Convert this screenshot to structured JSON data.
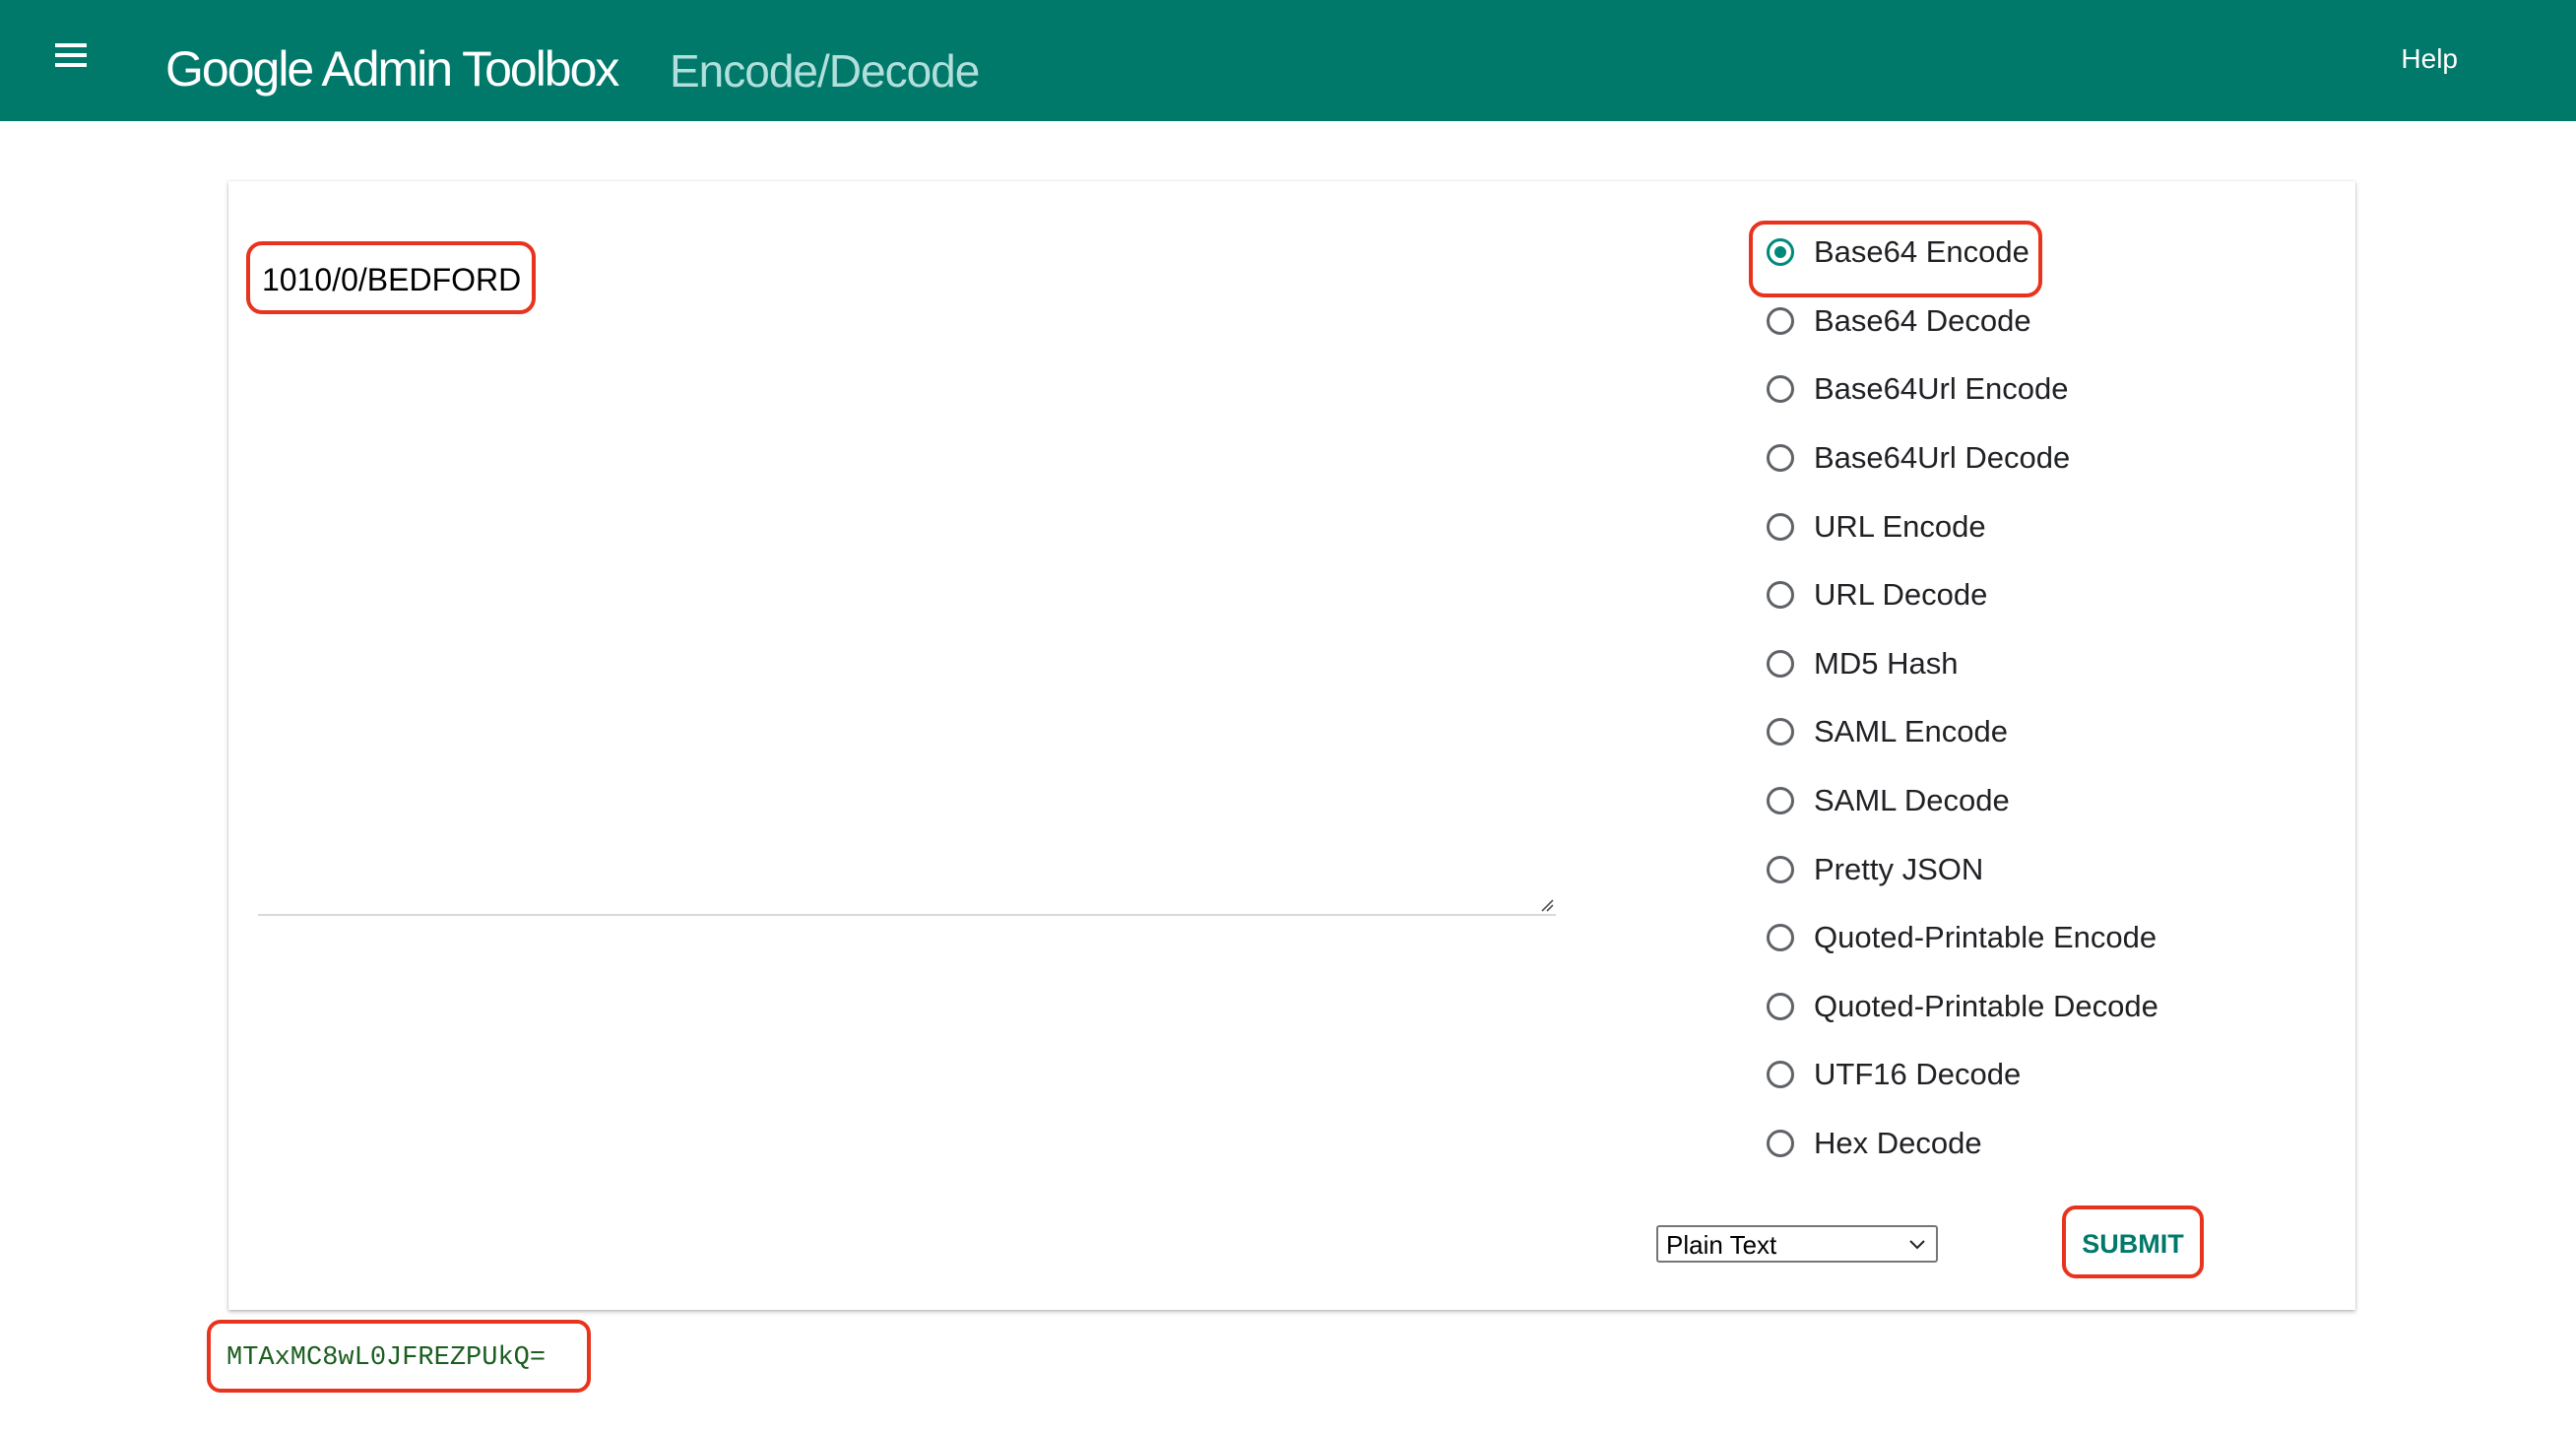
{
  "header": {
    "brand": "Google Admin Toolbox",
    "subtitle": "Encode/Decode",
    "help_label": "Help"
  },
  "input": {
    "value": "1010/0/BEDFORD"
  },
  "operations": [
    {
      "label": "Base64 Encode",
      "checked": true
    },
    {
      "label": "Base64 Decode",
      "checked": false
    },
    {
      "label": "Base64Url Encode",
      "checked": false
    },
    {
      "label": "Base64Url Decode",
      "checked": false
    },
    {
      "label": "URL Encode",
      "checked": false
    },
    {
      "label": "URL Decode",
      "checked": false
    },
    {
      "label": "MD5 Hash",
      "checked": false
    },
    {
      "label": "SAML Encode",
      "checked": false
    },
    {
      "label": "SAML Decode",
      "checked": false
    },
    {
      "label": "Pretty JSON",
      "checked": false
    },
    {
      "label": "Quoted-Printable Encode",
      "checked": false
    },
    {
      "label": "Quoted-Printable Decode",
      "checked": false
    },
    {
      "label": "UTF16 Decode",
      "checked": false
    },
    {
      "label": "Hex Decode",
      "checked": false
    }
  ],
  "format": {
    "selected": "Plain Text"
  },
  "submit_label": "SUBMIT",
  "output": {
    "value": "MTAxMC8wL0JFREZPUkQ="
  },
  "colors": {
    "header_bg": "#00796b",
    "accent": "#00897b",
    "highlight": "#e8331d",
    "output_text": "#1b5e20"
  }
}
